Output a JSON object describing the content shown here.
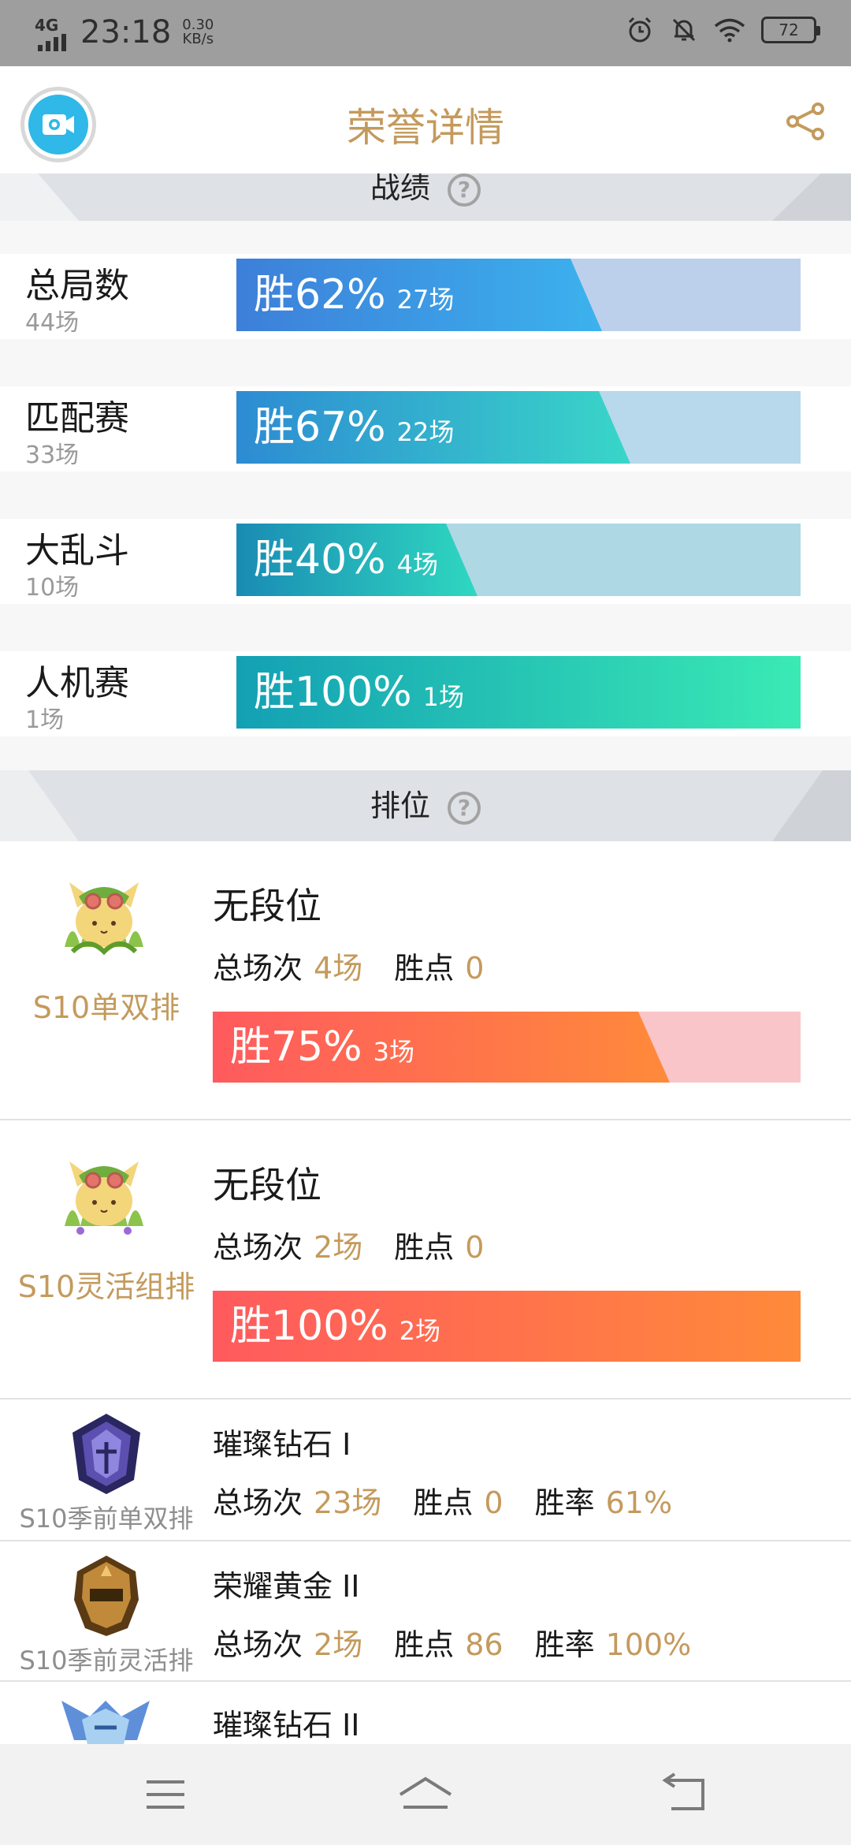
{
  "status_bar": {
    "network": "4G",
    "time": "23:18",
    "speed_value": "0.30",
    "speed_unit": "KB/s",
    "battery": "72",
    "icons": [
      "alarm-icon",
      "mute-icon",
      "wifi-icon",
      "battery-icon"
    ]
  },
  "header": {
    "title": "荣誉详情",
    "left_icon": "video-camera-icon",
    "right_icon": "share-icon"
  },
  "colors": {
    "gold": "#c49a5c",
    "section_bg": "#dee1e5"
  },
  "stats_section": {
    "title": "战绩",
    "rows": [
      {
        "name": "总局数",
        "count": "44场",
        "win_text": "胜62%",
        "wins": "27场",
        "win_rate": 0.62,
        "track_color": "#bcd0ec",
        "fill_from": "#3d7fd9",
        "fill_to": "#3cb2ee"
      },
      {
        "name": "匹配赛",
        "count": "33场",
        "win_text": "胜67%",
        "wins": "22场",
        "win_rate": 0.67,
        "track_color": "#b8d8ec",
        "fill_from": "#2d8bd3",
        "fill_to": "#39d6c8"
      },
      {
        "name": "大乱斗",
        "count": "10场",
        "win_text": "胜40%",
        "wins": "4场",
        "win_rate": 0.4,
        "track_color": "#aed8e4",
        "fill_from": "#1a8bb4",
        "fill_to": "#2fd8c0"
      },
      {
        "name": "人机赛",
        "count": "1场",
        "win_text": "胜100%",
        "wins": "1场",
        "win_rate": 1.0,
        "track_color": "#b6e6dc",
        "fill_from": "#13a0b4",
        "fill_to": "#3aeab4"
      }
    ]
  },
  "ranked_section": {
    "title": "排位",
    "cards": [
      {
        "queue": "S10单双排",
        "tier": "无段位",
        "total_label": "总场次",
        "total": "4场",
        "points_label": "胜点",
        "points": "0",
        "win_text": "胜75%",
        "wins": "3场",
        "win_rate": 0.75,
        "emblem": "teemo-icon"
      },
      {
        "queue": "S10灵活组排",
        "tier": "无段位",
        "total_label": "总场次",
        "total": "2场",
        "points_label": "胜点",
        "points": "0",
        "win_text": "胜100%",
        "wins": "2场",
        "win_rate": 1.0,
        "emblem": "teemo-icon"
      }
    ],
    "preseason": [
      {
        "queue": "S10季前单双排",
        "tier": "璀璨钻石 I",
        "total_label": "总场次",
        "total": "23场",
        "points_label": "胜点",
        "points": "0",
        "rate_label": "胜率",
        "rate": "61%",
        "emblem": "diamond-emblem-icon"
      },
      {
        "queue": "S10季前灵活排",
        "tier": "荣耀黄金 II",
        "total_label": "总场次",
        "total": "2场",
        "points_label": "胜点",
        "points": "86",
        "rate_label": "胜率",
        "rate": "100%",
        "emblem": "gold-emblem-icon"
      },
      {
        "queue": "",
        "tier": "璀璨钻石 II",
        "emblem": "platinum-emblem-icon"
      }
    ]
  },
  "nav": {
    "icons": [
      "menu-icon",
      "home-icon",
      "back-icon"
    ]
  }
}
